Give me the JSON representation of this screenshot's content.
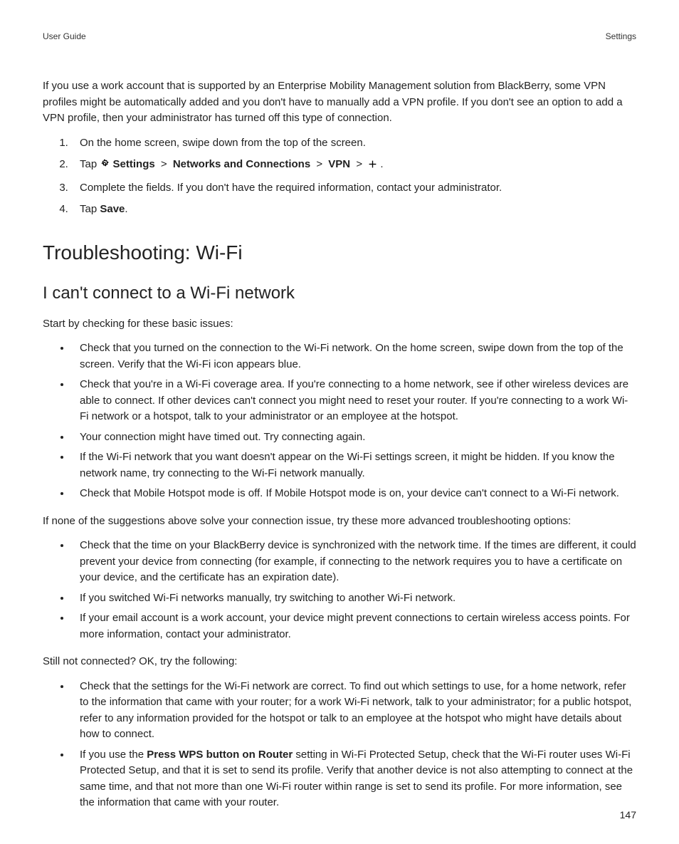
{
  "header": {
    "left": "User Guide",
    "right": "Settings"
  },
  "intro": "If you use a work account that is supported by an Enterprise Mobility Management solution from BlackBerry, some VPN profiles might be automatically added and you don't have to manually add a VPN profile. If you don't see an option to add a VPN profile, then your administrator has turned off this type of connection.",
  "steps": {
    "s1": "On the home screen, swipe down from the top of the screen.",
    "s2": {
      "prefix": "Tap ",
      "path1": "Settings",
      "sep": ">",
      "path2": "Networks and Connections",
      "path3": "VPN",
      "suffix": "."
    },
    "s3": "Complete the fields. If you don't have the required information, contact your administrator.",
    "s4": {
      "prefix": "Tap ",
      "bold": "Save",
      "suffix": "."
    }
  },
  "h1": "Troubleshooting: Wi-Fi",
  "h2": "I can't connect to a Wi-Fi network",
  "lead1": "Start by checking for these basic issues:",
  "list1": {
    "b1": "Check that you turned on the connection to the Wi-Fi network. On the home screen, swipe down from the top of the screen. Verify that the Wi-Fi icon appears blue.",
    "b2": "Check that you're in a Wi-Fi coverage area. If you're connecting to a home network, see if other wireless devices are able to connect. If other devices can't connect you might need to reset your router. If you're connecting to a work Wi-Fi network or a hotspot, talk to your administrator or an employee at the hotspot.",
    "b3": "Your connection might have timed out. Try connecting again.",
    "b4": "If the Wi-Fi network that you want doesn't appear on the Wi-Fi settings screen, it might be hidden. If you know the network name, try connecting to the Wi-Fi network manually.",
    "b5": "Check that Mobile Hotspot mode is off. If Mobile Hotspot mode is on, your device can't connect to a Wi-Fi network."
  },
  "lead2": "If none of the suggestions above solve your connection issue, try these more advanced troubleshooting options:",
  "list2": {
    "b1": "Check that the time on your BlackBerry device is synchronized with the network time. If the times are different, it could prevent your device from connecting (for example, if connecting to the network requires you to have a certificate on your device, and the certificate has an expiration date).",
    "b2": "If you switched Wi-Fi networks manually, try switching to another Wi-Fi network.",
    "b3": "If your email account is a work account, your device might prevent connections to certain wireless access points. For more information, contact your administrator."
  },
  "lead3": "Still not connected? OK, try the following:",
  "list3": {
    "b1": "Check that the settings for the Wi-Fi network are correct. To find out which settings to use, for a home network, refer to the information that came with your router; for a work Wi-Fi network, talk to your administrator; for a public hotspot, refer to any information provided for the hotspot or talk to an employee at the hotspot who might have details about how to connect.",
    "b2": {
      "pre": "If you use the ",
      "bold": "Press WPS button on Router",
      "post": " setting in Wi-Fi Protected Setup, check that the Wi-Fi router uses Wi-Fi Protected Setup, and that it is set to send its profile. Verify that another device is not also attempting to connect at the same time, and that not more than one Wi-Fi router within range is set to send its profile. For more information, see the information that came with your router."
    }
  },
  "pageNumber": "147"
}
